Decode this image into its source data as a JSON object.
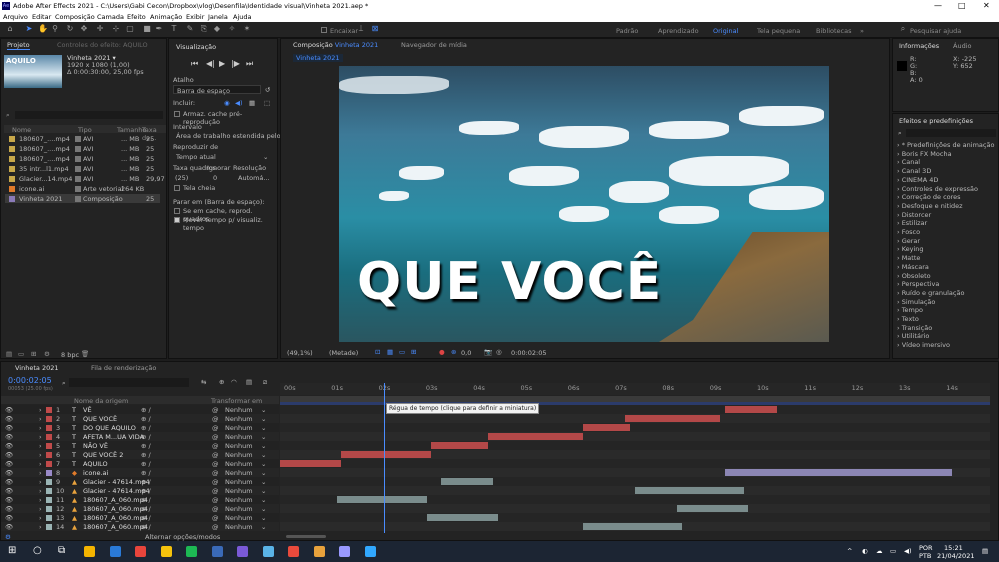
{
  "window": {
    "title": "Adobe After Effects 2021 - C:\\Users\\Gabi Cecon\\Dropbox\\vlog\\Desenfila\\Identidade visual\\Vinheta 2021.aep *",
    "minimize": "—",
    "maximize": "□",
    "close": "✕"
  },
  "menu": [
    "Arquivo",
    "Editar",
    "Composição",
    "Camada",
    "Efeito",
    "Animação",
    "Exibir",
    "Janela",
    "Ajuda"
  ],
  "toolbar": {
    "encaixar": "Encaixar",
    "workspaces": [
      "Padrão",
      "Aprendizado",
      "Original",
      "Tela pequena",
      "Bibliotecas"
    ],
    "active_workspace": "Original",
    "search": "Pesquisar ajuda"
  },
  "project": {
    "tab": "Projeto",
    "tab2": "Controles do efeito: AQUILO",
    "thumb_text": "AQUILO",
    "comp_name": "Vinheta 2021 ▾",
    "comp_info1": "1920 x 1080 (1,00)",
    "comp_info2": "Δ 0:00:30:00, 25,00 fps",
    "columns": [
      "Nome",
      "Tipo",
      "Tamanho",
      "Taxa de..."
    ],
    "items": [
      {
        "name": "180607_....mp4",
        "type": "AVI",
        "size": "... MB",
        "rate": "25",
        "color": "#c8a84a"
      },
      {
        "name": "180607_....mp4",
        "type": "AVI",
        "size": "... MB",
        "rate": "25",
        "color": "#c8a84a"
      },
      {
        "name": "180607_....mp4",
        "type": "AVI",
        "size": "... MB",
        "rate": "25",
        "color": "#c8a84a"
      },
      {
        "name": "35 intr...l1.mp4",
        "type": "AVI",
        "size": "... MB",
        "rate": "25",
        "color": "#c8a84a"
      },
      {
        "name": "Glacier...14.mp4",
        "type": "AVI",
        "size": "... MB",
        "rate": "29,97",
        "color": "#c8a84a"
      },
      {
        "name": "icone.ai",
        "type": "Arte vetorial",
        "size": "264 KB",
        "rate": "",
        "color": "#e07a2a"
      },
      {
        "name": "Vinheta 2021",
        "type": "Composição",
        "size": "",
        "rate": "25",
        "color": "#8a7ab8"
      }
    ],
    "bpc": "8 bpc"
  },
  "preview": {
    "tab": "Visualização",
    "atalho": "Atalho",
    "atalho_val": "Barra de espaço",
    "incluir": "Incluir:",
    "cache": "Armaz. cache pré-reprodução",
    "intervalo": "Intervalo",
    "intervalo_val": "Área de trabalho estendida pelo ...",
    "reproduzir": "Reproduzir de",
    "reproduzir_val": "Tempo atual",
    "taxa": "Taxa quadros",
    "ignorar": "Ignorar",
    "resolucao": "Resolução",
    "taxa_val": "(25)",
    "ignorar_val": "0",
    "resolucao_val": "Automá...",
    "tela_cheia": "Tela cheia",
    "parar": "Parar em (Barra de espaço):",
    "se_em_cache": "Se em cache, reprod. quadros",
    "mover": "Mover tempo p/ visualiz. tempo"
  },
  "comp": {
    "tab": "Composição",
    "tab_name": "Vinheta 2021",
    "tab2": "Navegador de mídia",
    "sub_tab": "Vinheta 2021",
    "overlay_text": "QUE VOCÊ",
    "zoom": "(49,1%)",
    "quality": "(Metade)",
    "timecode": "0:00:02:05"
  },
  "info": {
    "tab": "Informações",
    "tab2": "Áudio",
    "r": "R:",
    "g": "G:",
    "b": "B:",
    "a": "A: 0",
    "x": "X: -225",
    "y": "Y: 652"
  },
  "effects": {
    "tab": "Efeitos e predefinições",
    "items": [
      "* Predefinições de animação",
      "Boris FX Mocha",
      "Canal",
      "Canal 3D",
      "CINEMA 4D",
      "Controles de expressão",
      "Correção de cores",
      "Desfoque e nitidez",
      "Distorcer",
      "Estilizar",
      "Fosco",
      "Gerar",
      "Keying",
      "Matte",
      "Máscara",
      "Obsoleto",
      "Perspectiva",
      "Ruído e granulação",
      "Simulação",
      "Tempo",
      "Texto",
      "Transição",
      "Utilitário",
      "Vídeo imersivo"
    ]
  },
  "timeline": {
    "tab": "Vinheta 2021",
    "tab2": "Fila de renderização",
    "timecode": "0:00:02:05",
    "sub": "00053 (25.00 fps)",
    "col_source": "Nome da origem",
    "col_parent": "Transformar em principal...",
    "ruler": [
      "00s",
      "01s",
      "02s",
      "03s",
      "04s",
      "05s",
      "06s",
      "07s",
      "08s",
      "09s",
      "10s",
      "11s",
      "12s",
      "13s",
      "14s"
    ],
    "tooltip": "Régua de tempo (clique para definir a miniatura)",
    "layers": [
      {
        "n": "1",
        "name": "VÊ",
        "kind": "T",
        "color": "#c04a4a",
        "parent": "Nenhum",
        "start": 9.4,
        "end": 10.5,
        "bar": "#b34848"
      },
      {
        "n": "2",
        "name": "QUE VOCÊ",
        "kind": "T",
        "color": "#c04a4a",
        "parent": "Nenhum",
        "start": 7.3,
        "end": 9.3,
        "bar": "#b34848"
      },
      {
        "n": "3",
        "name": "DO QUE AQUILO",
        "kind": "T",
        "color": "#c04a4a",
        "parent": "Nenhum",
        "start": 6.4,
        "end": 7.4,
        "bar": "#b34848"
      },
      {
        "n": "4",
        "name": "AFETA M...UA VIDA",
        "kind": "T",
        "color": "#c04a4a",
        "parent": "Nenhum",
        "start": 4.4,
        "end": 6.4,
        "bar": "#b34848"
      },
      {
        "n": "5",
        "name": "NÃO VÊ",
        "kind": "T",
        "color": "#c04a4a",
        "parent": "Nenhum",
        "start": 3.2,
        "end": 4.4,
        "bar": "#b34848"
      },
      {
        "n": "6",
        "name": "QUE VOCÊ 2",
        "kind": "T",
        "color": "#c04a4a",
        "parent": "Nenhum",
        "start": 1.3,
        "end": 3.2,
        "bar": "#b34848"
      },
      {
        "n": "7",
        "name": "AQUILO",
        "kind": "T",
        "color": "#c04a4a",
        "parent": "Nenhum",
        "start": 0,
        "end": 1.3,
        "bar": "#b34848"
      },
      {
        "n": "8",
        "name": "icone.ai",
        "kind": "ai",
        "color": "#9a8ac8",
        "parent": "Nenhum",
        "start": 9.4,
        "end": 14.2,
        "bar": "#8c86b4"
      },
      {
        "n": "9",
        "name": "Glacier - 47614.mp4",
        "kind": "v",
        "color": "#9ab4b4",
        "parent": "Nenhum",
        "start": 3.4,
        "end": 4.5,
        "bar": "#7a8c8c"
      },
      {
        "n": "10",
        "name": "Glacier - 47614.mp4",
        "kind": "v",
        "color": "#9ab4b4",
        "parent": "Nenhum",
        "start": 7.5,
        "end": 9.8,
        "bar": "#7a8c8c"
      },
      {
        "n": "11",
        "name": "180607_A_060.mp4",
        "kind": "v",
        "color": "#9ab4b4",
        "parent": "Nenhum",
        "start": 1.2,
        "end": 3.1,
        "bar": "#7a8c8c"
      },
      {
        "n": "12",
        "name": "180607_A_060.mp4",
        "kind": "v",
        "color": "#9ab4b4",
        "parent": "Nenhum",
        "start": 8.4,
        "end": 9.9,
        "bar": "#7a8c8c"
      },
      {
        "n": "13",
        "name": "180607_A_060.mp4",
        "kind": "v",
        "color": "#9ab4b4",
        "parent": "Nenhum",
        "start": 3.1,
        "end": 4.6,
        "bar": "#7a8c8c"
      },
      {
        "n": "14",
        "name": "180607_A_060.mp4",
        "kind": "v",
        "color": "#9ab4b4",
        "parent": "Nenhum",
        "start": 6.4,
        "end": 8.5,
        "bar": "#7a8c8c"
      }
    ],
    "footer": "Alternar opções/modos"
  },
  "taskbar": {
    "lang": "POR",
    "lang2": "PTB",
    "time": "15:21",
    "date": "21/04/2021",
    "apps": [
      "#f4b400",
      "#2a7ad8",
      "#e8453c",
      "#f4c20d",
      "#1db954",
      "#3a6ab8",
      "#7a5ad8",
      "#5ab4e8",
      "#e84a3c",
      "#e8a23c",
      "#9999ff",
      "#31a8ff"
    ]
  },
  "colors": {
    "accent": "#4a8cff",
    "playhead": "#4a8cff"
  }
}
